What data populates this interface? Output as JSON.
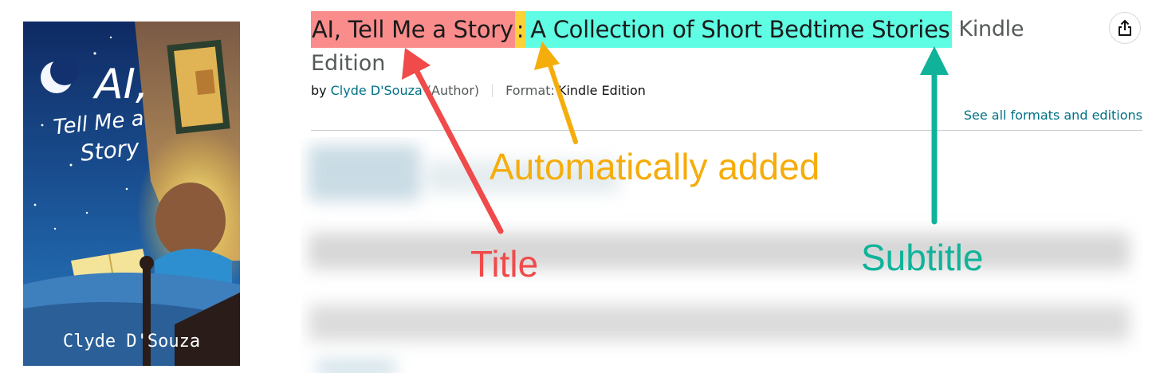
{
  "book": {
    "title": "AI, Tell Me a Story",
    "separator": ":",
    "subtitle": " A Collection of Short Bedtime Stories",
    "format_suffix": "Kindle",
    "format_suffix_line2": "Edition",
    "byline_prefix": "by",
    "author": "Clyde D'Souza",
    "author_role": "(Author)",
    "format_label": "Format:",
    "format_value": "Kindle Edition",
    "see_all_link": "See all formats and editions"
  },
  "cover": {
    "title_line1": "AI,",
    "title_line2": "Tell Me a",
    "title_line3": "Story",
    "author": "Clyde D'Souza"
  },
  "annotations": {
    "automatically_added": "Automatically added",
    "title": "Title",
    "subtitle": "Subtitle"
  },
  "colors": {
    "title_highlight": "#fa8c8c",
    "colon_highlight": "#fcd23a",
    "subtitle_highlight": "#5ffde3",
    "title_note": "#f04a4a",
    "auto_note": "#f5ad0b",
    "subtitle_note": "#10b39a",
    "link": "#007185"
  },
  "icons": {
    "share": "share-icon",
    "moon": "moon-icon"
  }
}
